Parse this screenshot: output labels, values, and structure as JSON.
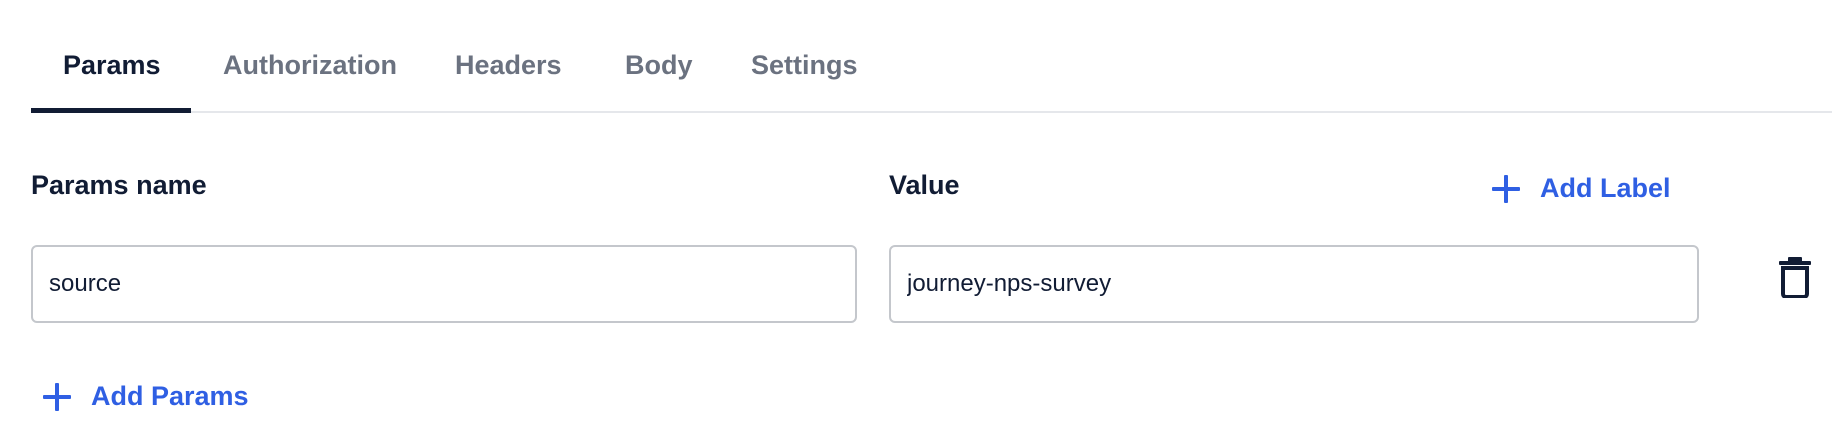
{
  "tabs": [
    {
      "label": "Params",
      "active": true
    },
    {
      "label": "Authorization",
      "active": false
    },
    {
      "label": "Headers",
      "active": false
    },
    {
      "label": "Body",
      "active": false
    },
    {
      "label": "Settings",
      "active": false
    }
  ],
  "params_table": {
    "name_header": "Params name",
    "value_header": "Value",
    "add_label_button": "Add Label",
    "rows": [
      {
        "name": "source",
        "value": "journey-nps-survey"
      }
    ],
    "add_params_button": "Add Params"
  },
  "icons": {
    "add_label": "plus-icon",
    "add_params": "plus-icon",
    "delete_row": "trash-icon"
  },
  "colors": {
    "accent": "#2f5fe3",
    "text_primary": "#111c34",
    "text_muted": "#6b7280",
    "border": "#c4c7cc"
  }
}
